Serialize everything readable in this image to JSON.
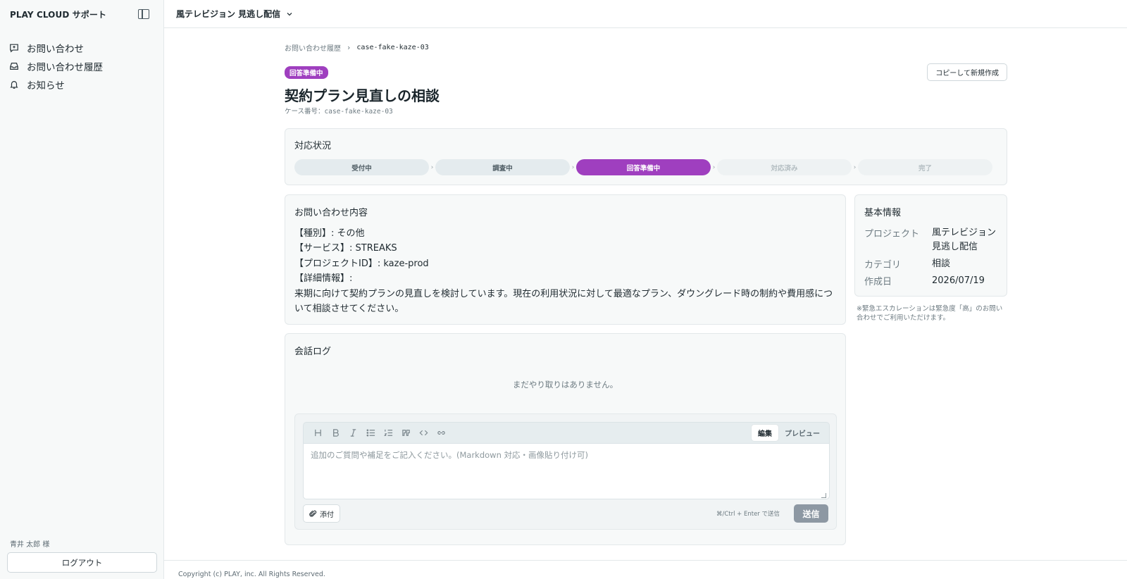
{
  "sidebar": {
    "brand": "PLAY CLOUD サポート",
    "items": [
      {
        "label": "お問い合わせ",
        "icon": "message-plus-icon"
      },
      {
        "label": "お問い合わせ履歴",
        "icon": "inbox-icon"
      },
      {
        "label": "お知らせ",
        "icon": "bell-icon"
      }
    ],
    "user": "青井 太郎 様",
    "logout_label": "ログアウト"
  },
  "topbar": {
    "project": "風テレビジョン 見逃し配信"
  },
  "breadcrumb": {
    "parent": "お問い合わせ履歴",
    "separator": "›",
    "current": "case-fake-kaze-03"
  },
  "case": {
    "status_badge": "回答準備中",
    "copy_button": "コピーして新規作成",
    "title": "契約プラン見直しの相談",
    "number_label": "ケース番号：",
    "number": "case-fake-kaze-03"
  },
  "status": {
    "title": "対応状況",
    "steps": [
      {
        "label": "受付中",
        "state": "done"
      },
      {
        "label": "調査中",
        "state": "done"
      },
      {
        "label": "回答準備中",
        "state": "active"
      },
      {
        "label": "対応済み",
        "state": "todo"
      },
      {
        "label": "完了",
        "state": "todo"
      }
    ]
  },
  "inquiry": {
    "title": "お問い合わせ内容",
    "lines": [
      "【種別】: その他",
      "【サービス】: STREAKS",
      "【プロジェクトID】: kaze-prod",
      "【詳細情報】:",
      "来期に向けて契約プランの見直しを検討しています。現在の利用状況に対して最適なプラン、ダウングレード時の制約や費用感について相談させてください。"
    ]
  },
  "info": {
    "title": "基本情報",
    "project_key": "プロジェクト",
    "project_value": "風テレビジョン見逃し配信",
    "category_key": "カテゴリ",
    "category_value": "相談",
    "created_key": "作成日",
    "created_value": "2026/07/19",
    "note": "※緊急エスカレーションは緊急度「高」のお問い合わせでご利用いただけます。"
  },
  "log": {
    "title": "会話ログ",
    "empty": "まだやり取りはありません。",
    "toolbar": [
      "heading-icon",
      "bold-icon",
      "italic-icon",
      "bullet-list-icon",
      "numbered-list-icon",
      "quote-icon",
      "code-icon",
      "link-icon"
    ],
    "tab_edit": "編集",
    "tab_preview": "プレビュー",
    "placeholder": "追加のご質問や補足をご記入ください。(Markdown 対応・画像貼り付け可)",
    "attach": "添付",
    "hint": "⌘/Ctrl + Enter で送信",
    "send": "送信"
  },
  "footer": "Copyright (c) PLAY, inc. All Rights Reserved.",
  "colors": {
    "accent": "#9f3fbf",
    "send_disabled": "#8d98a3"
  }
}
